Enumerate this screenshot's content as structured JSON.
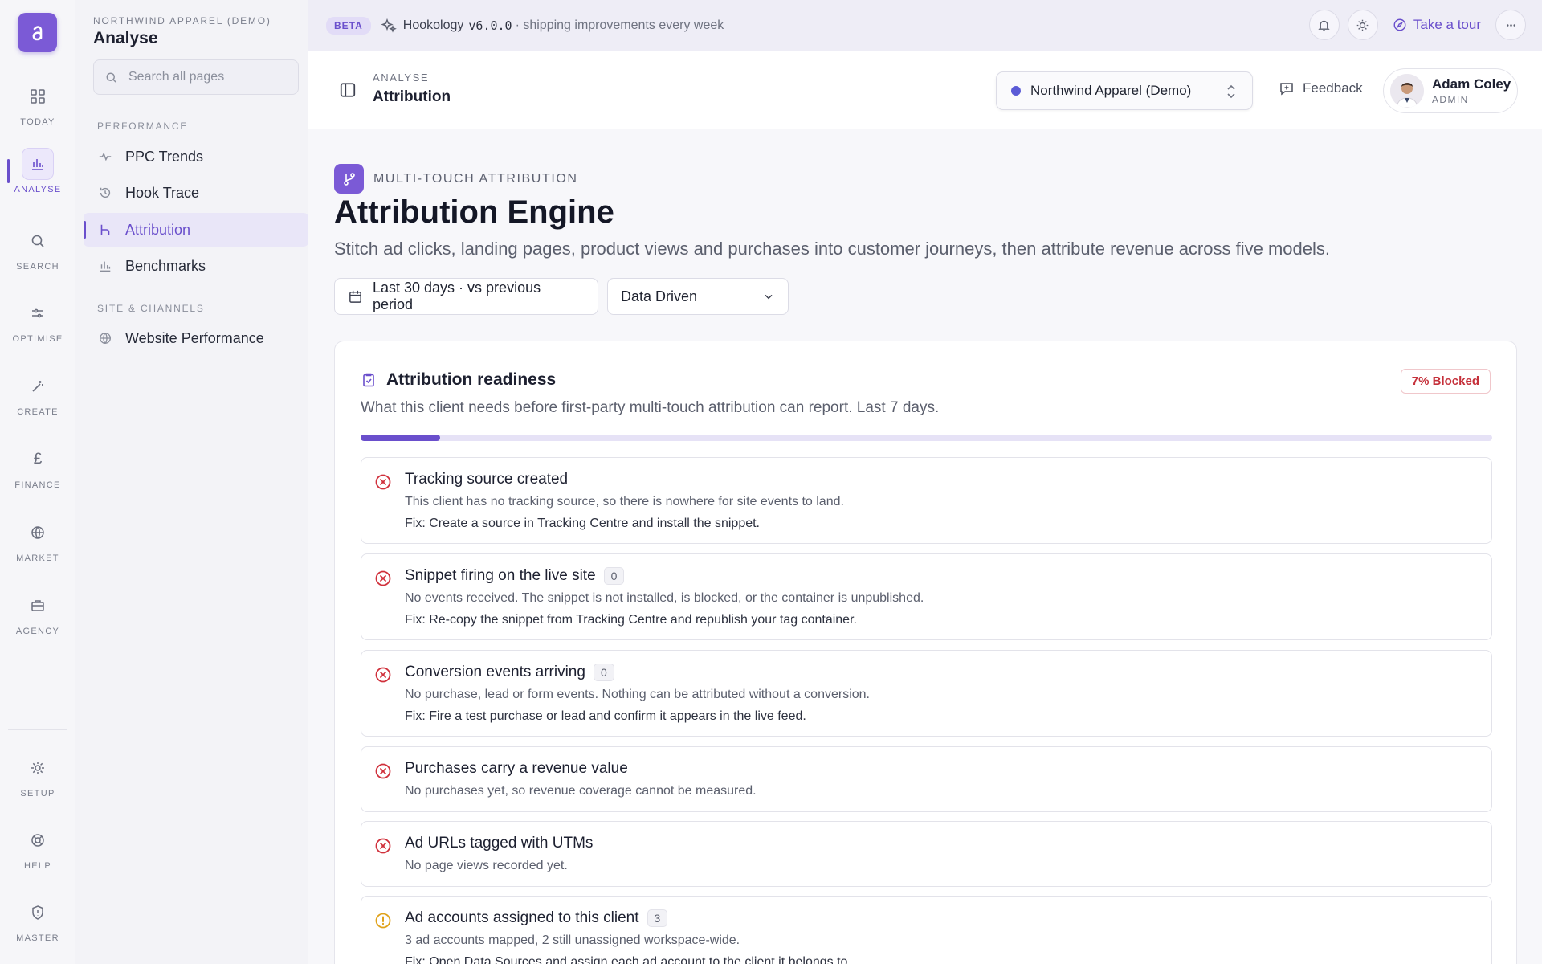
{
  "rail": {
    "items": [
      {
        "label": "TODAY",
        "icon": "grid-icon"
      },
      {
        "label": "ANALYSE",
        "icon": "bar-chart-icon",
        "active": true
      },
      {
        "label": "SEARCH",
        "icon": "search-icon"
      },
      {
        "label": "OPTIMISE",
        "icon": "sliders-icon"
      },
      {
        "label": "CREATE",
        "icon": "magic-wand-icon"
      },
      {
        "label": "FINANCE",
        "icon": "pound-icon"
      },
      {
        "label": "MARKET",
        "icon": "globe-icon"
      },
      {
        "label": "AGENCY",
        "icon": "briefcase-icon"
      },
      {
        "label": "SETUP",
        "icon": "gear-icon"
      },
      {
        "label": "HELP",
        "icon": "lifebuoy-icon"
      },
      {
        "label": "MASTER",
        "icon": "shield-icon"
      }
    ]
  },
  "sidebar": {
    "org": "NORTHWIND APPAREL (DEMO)",
    "title": "Analyse",
    "search_placeholder": "Search all pages",
    "sections": [
      {
        "label": "PERFORMANCE",
        "items": [
          "PPC Trends",
          "Hook Trace",
          "Attribution",
          "Benchmarks"
        ]
      },
      {
        "label": "SITE & CHANNELS",
        "items": [
          "Website Performance"
        ]
      }
    ],
    "active_item": "Attribution"
  },
  "banner": {
    "badge": "BETA",
    "product": "Hookology",
    "version": "v6.0.0",
    "tagline": "· shipping improvements every week",
    "tour_label": "Take a tour"
  },
  "header": {
    "crumb": "ANALYSE",
    "page": "Attribution",
    "client": "Northwind Apparel (Demo)",
    "feedback": "Feedback",
    "user_name": "Adam Coley",
    "user_role": "ADMIN"
  },
  "main": {
    "kicker": "MULTI-TOUCH ATTRIBUTION",
    "title": "Attribution Engine",
    "lead": "Stitch ad clicks, landing pages, product views and purchases into customer journeys, then attribute revenue across five models.",
    "date_filter": "Last 30 days · vs previous period",
    "model_select": "Data Driven"
  },
  "readiness": {
    "title": "Attribution readiness",
    "description": "What this client needs before first-party multi-touch attribution can report. Last 7 days.",
    "blocked_badge": "7% Blocked",
    "progress_fraction": 0.07,
    "colors": {
      "error": "#d0303b",
      "warning": "#e0a21a",
      "accent": "#6a4fcc"
    },
    "checks": [
      {
        "title": "Tracking source created",
        "status": "error",
        "count": null,
        "desc": "This client has no tracking source, so there is nowhere for site events to land.",
        "fix": "Fix: Create a source in Tracking Centre and install the snippet."
      },
      {
        "title": "Snippet firing on the live site",
        "status": "error",
        "count": "0",
        "desc": "No events received. The snippet is not installed, is blocked, or the container is unpublished.",
        "fix": "Fix: Re-copy the snippet from Tracking Centre and republish your tag container."
      },
      {
        "title": "Conversion events arriving",
        "status": "error",
        "count": "0",
        "desc": "No purchase, lead or form events. Nothing can be attributed without a conversion.",
        "fix": "Fix: Fire a test purchase or lead and confirm it appears in the live feed."
      },
      {
        "title": "Purchases carry a revenue value",
        "status": "error",
        "count": null,
        "desc": "No purchases yet, so revenue coverage cannot be measured.",
        "fix": null
      },
      {
        "title": "Ad URLs tagged with UTMs",
        "status": "error",
        "count": null,
        "desc": "No page views recorded yet.",
        "fix": null
      },
      {
        "title": "Ad accounts assigned to this client",
        "status": "warning",
        "count": "3",
        "desc": "3 ad accounts mapped, 2 still unassigned workspace-wide.",
        "fix": "Fix: Open Data Sources and assign each ad account to the client it belongs to."
      }
    ]
  }
}
